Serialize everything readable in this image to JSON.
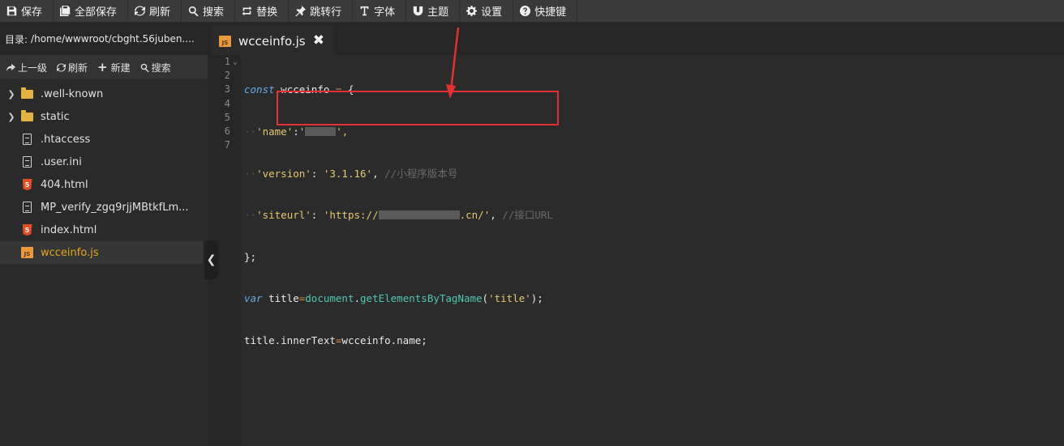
{
  "toolbar": {
    "buttons": [
      {
        "label": "保存",
        "icon": "floppy-icon"
      },
      {
        "label": "全部保存",
        "icon": "save-all-icon"
      },
      {
        "label": "刷新",
        "icon": "refresh-icon"
      },
      {
        "label": "搜索",
        "icon": "search-icon"
      },
      {
        "label": "替换",
        "icon": "replace-icon"
      },
      {
        "label": "跳转行",
        "icon": "pin-icon"
      },
      {
        "label": "字体",
        "icon": "font-icon"
      },
      {
        "label": "主题",
        "icon": "magnet-icon"
      },
      {
        "label": "设置",
        "icon": "gear-icon"
      },
      {
        "label": "快捷键",
        "icon": "help-icon"
      }
    ]
  },
  "sidebar": {
    "dir_label": "目录:",
    "dir_path": "/home/wwwroot/cbght.56juben....",
    "actions": {
      "up": "上一级",
      "refresh": "刷新",
      "new": "新建",
      "search": "搜索"
    },
    "files": [
      {
        "name": ".well-known",
        "type": "folder"
      },
      {
        "name": "static",
        "type": "folder"
      },
      {
        "name": ".htaccess",
        "type": "file"
      },
      {
        "name": ".user.ini",
        "type": "file"
      },
      {
        "name": "404.html",
        "type": "html"
      },
      {
        "name": "MP_verify_zgq9rjjMBtkfLm...",
        "type": "file"
      },
      {
        "name": "index.html",
        "type": "html"
      },
      {
        "name": "wcceinfo.js",
        "type": "js",
        "active": true
      }
    ]
  },
  "tab": {
    "title": "wcceinfo.js",
    "close": "✖"
  },
  "editor": {
    "line_numbers": [
      "1",
      "2",
      "3",
      "4",
      "5",
      "6",
      "7"
    ],
    "code": {
      "l1_kw": "const",
      "l1_name": "wcceinfo",
      "l1_eq": "=",
      "l1_brace": "{",
      "l2_key": "'name'",
      "l2_open": "'",
      "l2_close": "',",
      "l3_key": "'version'",
      "l3_val": "'3.1.16'",
      "l3_comment": "//小程序版本号",
      "l4_key": "'siteurl'",
      "l4_val_start": "'https://",
      "l4_val_end": ".cn/'",
      "l4_comment": "//接口URL",
      "l5": "};",
      "l6_kw": "var",
      "l6_var": "title",
      "l6_obj": "document",
      "l6_fn": "getElementsByTagName",
      "l6_arg": "'title'",
      "l6_end": ");",
      "l7": "title.innerText",
      "l7_eq": "=",
      "l7_val": "wcceinfo.name;"
    }
  },
  "colors": {
    "accent": "#e6a817",
    "annotation": "#e53030"
  }
}
